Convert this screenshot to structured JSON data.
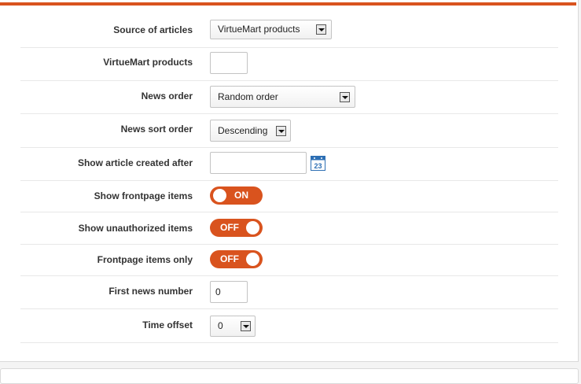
{
  "fields": {
    "source": {
      "label": "Source of articles",
      "value": "VirtueMart products"
    },
    "vm_products": {
      "label": "VirtueMart products",
      "value": ""
    },
    "news_order": {
      "label": "News order",
      "value": "Random order"
    },
    "news_sort_order": {
      "label": "News sort order",
      "value": "Descending"
    },
    "created_after": {
      "label": "Show article created after",
      "value": "",
      "calendar_day": "23"
    },
    "frontpage_items": {
      "label": "Show frontpage items",
      "state": "ON"
    },
    "unauthorized_items": {
      "label": "Show unauthorized items",
      "state": "OFF"
    },
    "frontpage_only": {
      "label": "Frontpage items only",
      "state": "OFF"
    },
    "first_news_number": {
      "label": "First news number",
      "value": "0"
    },
    "time_offset": {
      "label": "Time offset",
      "value": "0"
    }
  },
  "colors": {
    "accent": "#d9531e",
    "calendar_blue": "#2d6fb4"
  },
  "icons": {
    "dropdown": "chevron-down-icon",
    "calendar": "calendar-icon"
  }
}
